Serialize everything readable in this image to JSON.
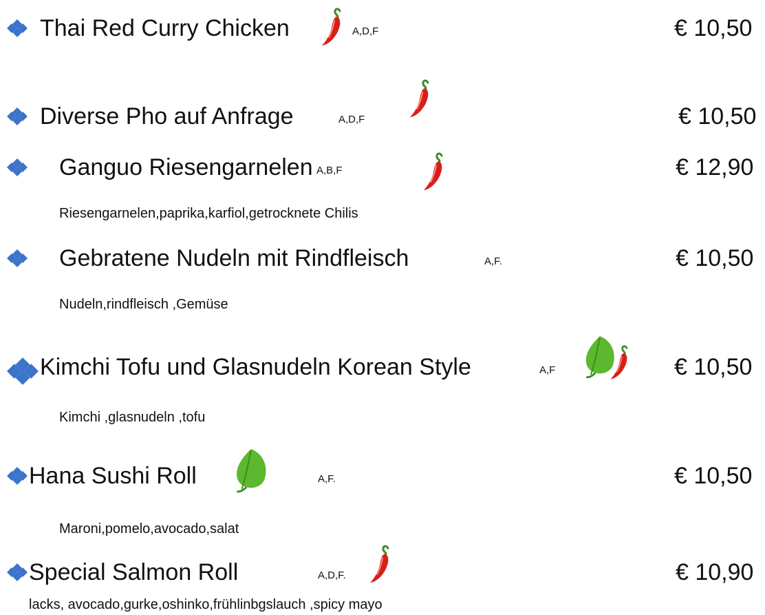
{
  "colors": {
    "bullet": "#3b74c9",
    "chili": "#d71f1a",
    "chili_stem": "#3b8a2a",
    "leaf": "#5cb82e"
  },
  "items": [
    {
      "name": "Thai Red Curry Chicken",
      "allergens": "A,D,F",
      "price": "€ 10,50",
      "description": "",
      "icons": [
        "chili-icon"
      ]
    },
    {
      "name": "Diverse Pho auf Anfrage",
      "allergens": "A,D,F",
      "price": "€ 10,50",
      "description": "",
      "icons": [
        "chili-icon"
      ]
    },
    {
      "name": "Ganguo Riesengarnelen",
      "allergens": "A,B,F",
      "price": "€ 12,90",
      "description": "Riesengarnelen,paprika,karfiol,getrocknete Chilis",
      "icons": [
        "chili-icon"
      ]
    },
    {
      "name": "Gebratene Nudeln mit Rindfleisch",
      "allergens": "A,F.",
      "price": "€ 10,50",
      "description": "Nudeln,rindfleisch ,Gemüse",
      "icons": []
    },
    {
      "name": "Kimchi Tofu und Glasnudeln  Korean Style",
      "allergens": "A,F",
      "price": "€ 10,50",
      "description": "Kimchi ,glasnudeln ,tofu",
      "icons": [
        "leaf-icon",
        "chili-icon"
      ]
    },
    {
      "name": "Hana Sushi  Roll",
      "allergens": "A,F.",
      "price": "€ 10,50",
      "description": "Maroni,pomelo,avocado,salat",
      "icons": [
        "leaf-icon"
      ]
    },
    {
      "name": "Special Salmon Roll",
      "allergens": "A,D,F.",
      "price": "€ 10,90",
      "description": "lacks, avocado,gurke,oshinko,frühlinbgslauch ,spicy mayo",
      "icons": [
        "chili-icon"
      ]
    }
  ]
}
